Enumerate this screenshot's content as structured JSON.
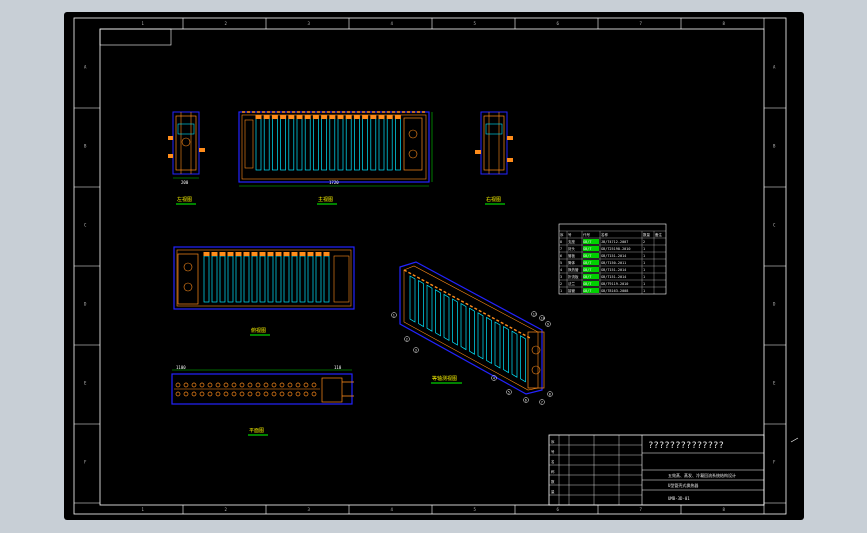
{
  "drawing": {
    "title_block": {
      "name": "??????????????",
      "desc_line1": "五效蒸、蒸发、冷凝回流系统结构设计",
      "desc_line2": "U型管壳式换热器",
      "code": "UMB-3D-01",
      "rows_left": [
        "序",
        "号",
        "名",
        "称",
        "数",
        "量"
      ]
    },
    "views": {
      "left_view": "左视图",
      "front_view": "主视图",
      "right_view": "右视图",
      "top_view": "俯视图",
      "section_view": "平面图",
      "iso_view": "等轴测视图"
    },
    "dims": {
      "left_width": "200",
      "front_length": "1720",
      "section_dim_a": "1100",
      "section_dim_b": "110"
    },
    "bom": {
      "header": [
        "序",
        "号",
        "代号",
        "名称",
        "数量",
        "备注"
      ],
      "rows": [
        [
          "8",
          "支座",
          "GB/T",
          "JB/T4712-2007",
          "2",
          ""
        ],
        [
          "7",
          "封头",
          "GB/T",
          "GB/T25198-2010",
          "1",
          ""
        ],
        [
          "6",
          "管板",
          "GB/T",
          "GB/T151-2014",
          "1",
          ""
        ],
        [
          "5",
          "筒体",
          "GB/T",
          "GB/T150-2011",
          "1",
          ""
        ],
        [
          "4",
          "换热管",
          "GB/T",
          "GB/T151-2014",
          "1",
          ""
        ],
        [
          "3",
          "折流板",
          "GB/T",
          "GB/T151-2014",
          "1",
          ""
        ],
        [
          "2",
          "法兰",
          "GB/T",
          "GB/T9119-2010",
          "1",
          ""
        ],
        [
          "1",
          "接管",
          "GB/T",
          "GB/T8163-2008",
          "1",
          ""
        ]
      ]
    },
    "zones_top": [
      "1",
      "2",
      "3",
      "4",
      "5",
      "6",
      "7",
      "8"
    ],
    "zones_side": [
      "A",
      "B",
      "C",
      "D",
      "E",
      "F"
    ],
    "balloons": [
      "1",
      "2",
      "3",
      "4",
      "5",
      "6",
      "7",
      "8",
      "9",
      "10",
      "11"
    ]
  },
  "colors": {
    "frame": "#ffffff",
    "orange": "#ff8c1a",
    "blue": "#2323ff",
    "cyan": "#00e6ff",
    "green": "#00d000",
    "yellow": "#f5f000"
  }
}
